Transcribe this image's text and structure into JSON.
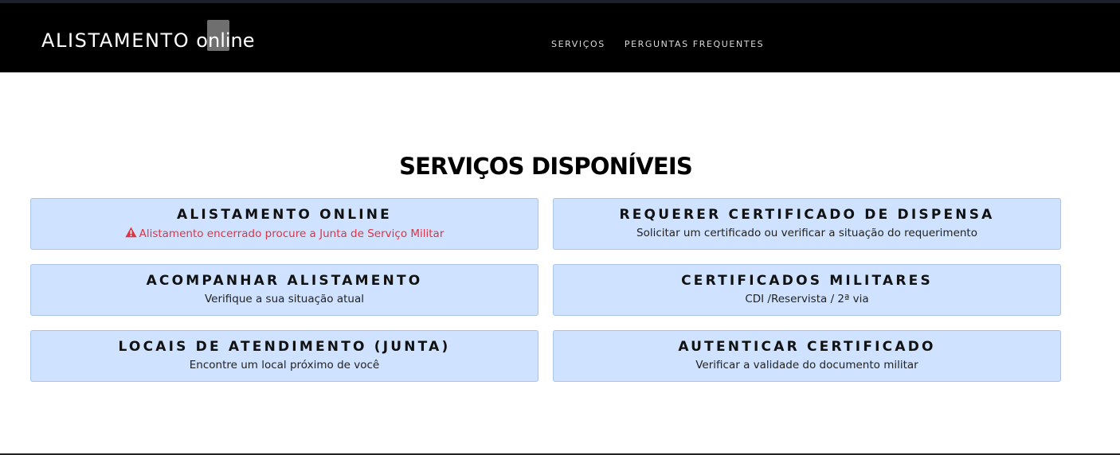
{
  "header": {
    "brand_part1": "ALISTAMENTO",
    "brand_part2": "online",
    "nav": [
      "SERVIÇOS",
      "PERGUNTAS FREQUENTES"
    ]
  },
  "main": {
    "title": "SERVIÇOS DISPONÍVEIS",
    "cards": [
      {
        "title": "ALISTAMENTO ONLINE",
        "desc": "Alistamento encerrado procure a Junta de Serviço Militar",
        "alert": true
      },
      {
        "title": "REQUERER CERTIFICADO DE DISPENSA",
        "desc": "Solicitar um certificado ou verificar a situação do requerimento"
      },
      {
        "title": "ACOMPANHAR ALISTAMENTO",
        "desc": "Verifique a sua situação atual"
      },
      {
        "title": "CERTIFICADOS MILITARES",
        "desc": "CDI /Reservista / 2ª via"
      },
      {
        "title": "LOCAIS DE ATENDIMENTO (JUNTA)",
        "desc": "Encontre um local próximo de você"
      },
      {
        "title": "AUTENTICAR CERTIFICADO",
        "desc": "Verificar a validade do documento militar"
      }
    ]
  },
  "colors": {
    "navbar": "#000000",
    "card_bg": "#cfe2ff",
    "card_border": "#a8c3ec",
    "alert": "#dc3545"
  },
  "icons": {
    "alert": "warning-triangle-icon"
  }
}
